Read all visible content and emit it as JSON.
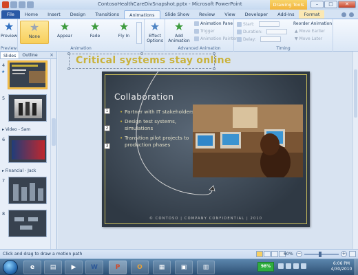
{
  "window": {
    "title": "ContosoHealthCareDivSnapshot.pptx - Microsoft PowerPoint",
    "contextual_group": "Drawing Tools",
    "minimize": "–",
    "maximize": "□",
    "close": "✕"
  },
  "tabs": [
    "File",
    "Home",
    "Insert",
    "Design",
    "Transitions",
    "Animations",
    "Slide Show",
    "Review",
    "View",
    "Developer",
    "Add-Ins",
    "Format"
  ],
  "ribbon": {
    "preview": {
      "label": "Preview",
      "group": "Preview"
    },
    "animation": {
      "items": [
        "None",
        "Appear",
        "Fade",
        "Fly In"
      ],
      "effect_options": "Effect Options",
      "group": "Animation"
    },
    "advanced": {
      "add_animation": "Add Animation",
      "pane": "Animation Pane",
      "trigger": "Trigger",
      "painter": "Animation Painter",
      "group": "Advanced Animation"
    },
    "timing": {
      "start": "Start:",
      "duration": "Duration:",
      "delay": "Delay:",
      "reorder": "Reorder Animation",
      "move_earlier": "Move Earlier",
      "move_later": "Move Later",
      "group": "Timing"
    }
  },
  "left_panel": {
    "tabs": [
      "Slides",
      "Outline"
    ],
    "close": "×",
    "sections": [
      {
        "label": "Video - Sam"
      },
      {
        "label": "Financial - Jack"
      }
    ],
    "slide_numbers": [
      "4",
      "5",
      "6",
      "7",
      "8"
    ]
  },
  "slide": {
    "animation_title": "Critical systems stay online",
    "title": "Collaboration",
    "bullets": [
      "Partner with IT stakeholders",
      "Design test systems, simulations",
      "Transition pilot projects to production phases"
    ],
    "markers": [
      "1",
      "2",
      "3"
    ],
    "footer": "© CONTOSO  |  COMPANY CONFIDENTIAL  |  2010"
  },
  "status": {
    "text": "Click and drag to draw a motion path",
    "zoom": "60%"
  },
  "taskbar": {
    "battery": "98%",
    "time": "6:06 PM",
    "date": "4/30/2010",
    "apps": [
      "W",
      "P",
      "O"
    ]
  }
}
